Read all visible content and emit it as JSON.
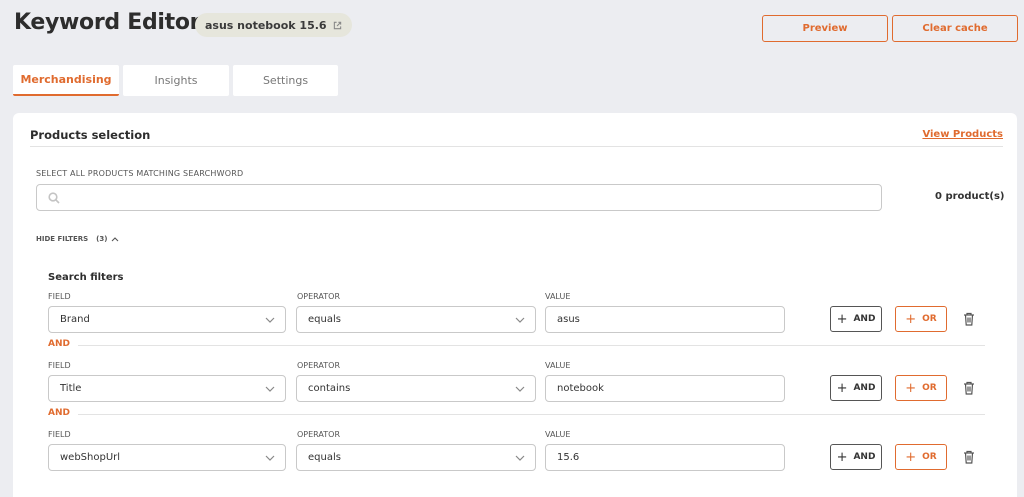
{
  "header": {
    "title": "Keyword Editor",
    "keyword_chip": "asus notebook 15.6",
    "preview_label": "Preview",
    "clear_cache_label": "Clear cache"
  },
  "tabs": [
    {
      "label": "Merchandising",
      "active": true
    },
    {
      "label": "Insights",
      "active": false
    },
    {
      "label": "Settings",
      "active": false
    }
  ],
  "products_selection": {
    "title": "Products selection",
    "view_products_label": "View Products",
    "search_label": "SELECT ALL PRODUCTS MATCHING SEARCHWORD",
    "search_value": "",
    "product_count": "0 product(s)",
    "hide_filters_label": "HIDE FILTERS",
    "filter_count": "(3)",
    "search_filters_title": "Search filters"
  },
  "filter_labels": {
    "field": "FIELD",
    "operator": "OPERATOR",
    "value": "VALUE",
    "and_button": "AND",
    "or_button": "OR",
    "separator": "AND"
  },
  "filters": [
    {
      "field": "Brand",
      "operator": "equals",
      "value": "asus"
    },
    {
      "field": "Title",
      "operator": "contains",
      "value": "notebook"
    },
    {
      "field": "webShopUrl",
      "operator": "equals",
      "value": "15.6"
    }
  ],
  "colors": {
    "accent": "#e06b2f",
    "background": "#ecedf1",
    "card": "#ffffff"
  }
}
